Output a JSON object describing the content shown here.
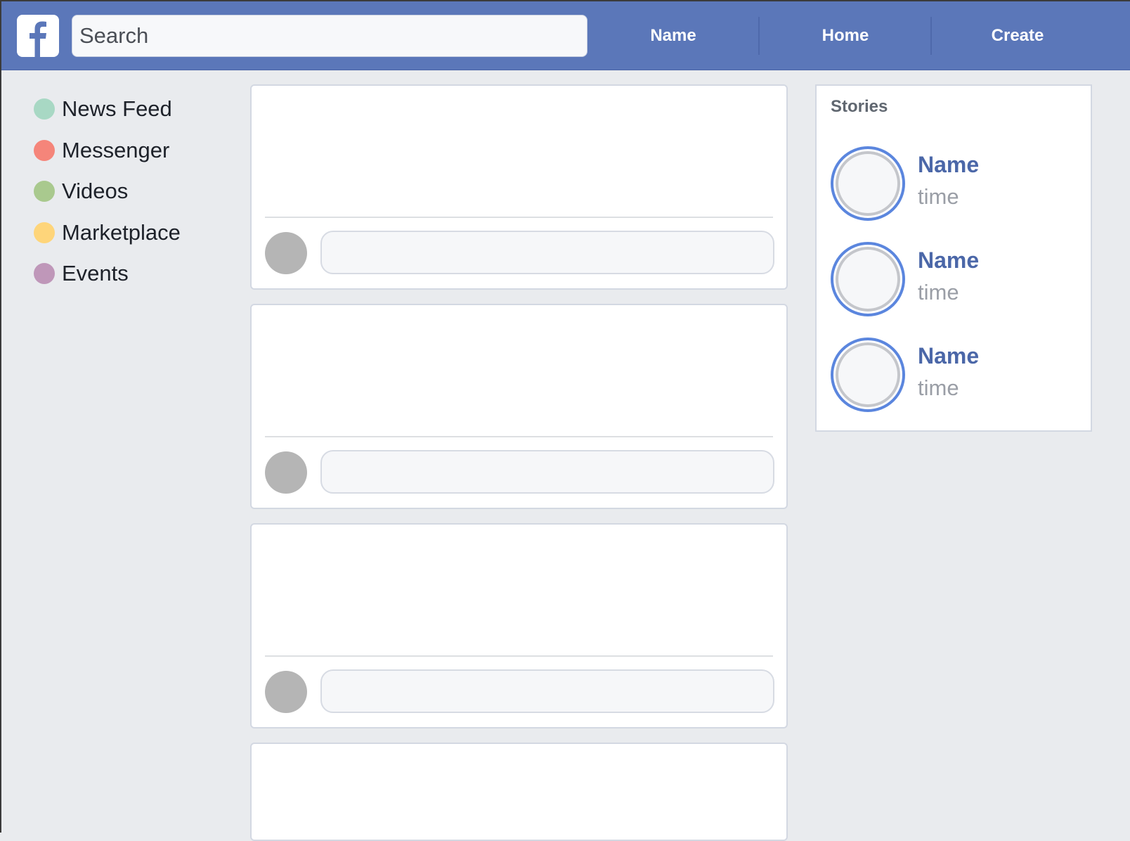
{
  "topbar": {
    "logo_icon": "facebook-f-icon",
    "search": {
      "placeholder": "Search",
      "value": ""
    },
    "nav": [
      {
        "label": "Name"
      },
      {
        "label": "Home"
      },
      {
        "label": "Create"
      }
    ]
  },
  "sidebar": {
    "items": [
      {
        "label": "News Feed",
        "color": "#a8d8c4"
      },
      {
        "label": "Messenger",
        "color": "#f5857a"
      },
      {
        "label": "Videos",
        "color": "#a9c98e"
      },
      {
        "label": "Marketplace",
        "color": "#fed57a"
      },
      {
        "label": "Events",
        "color": "#bf97b9"
      }
    ]
  },
  "feed": {
    "posts": [
      {
        "comment_placeholder": ""
      },
      {
        "comment_placeholder": ""
      },
      {
        "comment_placeholder": ""
      },
      {
        "comment_placeholder": ""
      }
    ]
  },
  "stories": {
    "title": "Stories",
    "items": [
      {
        "name": "Name",
        "time": "time"
      },
      {
        "name": "Name",
        "time": "time"
      },
      {
        "name": "Name",
        "time": "time"
      }
    ]
  },
  "colors": {
    "brand": "#5b77b9",
    "background": "#e9ebee",
    "story_ring": "#5b86de",
    "link": "#4b67a8"
  }
}
